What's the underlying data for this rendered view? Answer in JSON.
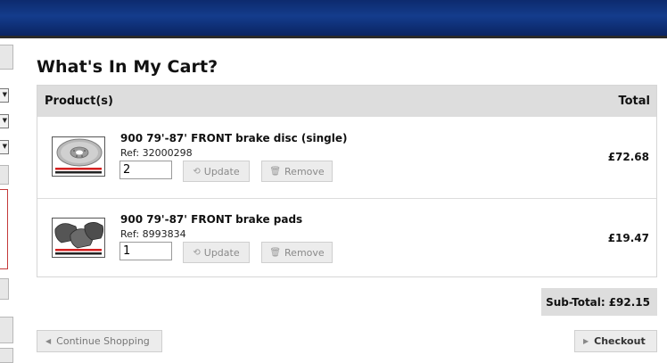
{
  "page": {
    "title": "What's In My Cart?"
  },
  "cart": {
    "columns": {
      "product": "Product(s)",
      "total": "Total"
    },
    "items": [
      {
        "name": "900 79'-87' FRONT brake disc (single)",
        "ref": "Ref: 32000298",
        "quantity": "2",
        "update_label": "Update",
        "remove_label": "Remove",
        "price": "£72.68",
        "thumb_icon": "brake-disc-icon",
        "thumb_caption": "LIBRARY PHOTO ONLY"
      },
      {
        "name": "900 79'-87' FRONT brake pads",
        "ref": "Ref: 8993834",
        "quantity": "1",
        "update_label": "Update",
        "remove_label": "Remove",
        "price": "£19.47",
        "thumb_icon": "brake-pads-icon",
        "thumb_caption": "LIBRARY PHOTO ONLY"
      }
    ],
    "subtotal_label": "Sub-Total:",
    "subtotal_value": "£92.15"
  },
  "actions": {
    "continue_label": "Continue Shopping",
    "checkout_label": "Checkout"
  },
  "colors": {
    "banner": "#143c8c",
    "header_row": "#dddddd",
    "button_bg": "#ececec"
  }
}
